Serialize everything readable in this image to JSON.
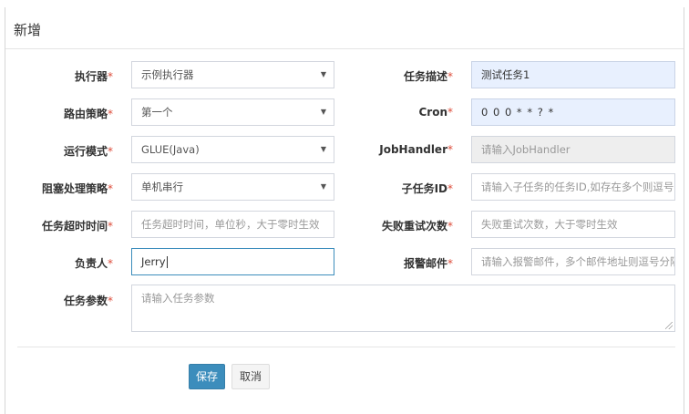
{
  "modal": {
    "title": "新增"
  },
  "form": {
    "executor": {
      "label": "执行器",
      "req": "*",
      "value": "示例执行器"
    },
    "job_desc": {
      "label": "任务描述",
      "req": "*",
      "value": "测试任务1"
    },
    "route_strategy": {
      "label": "路由策略",
      "req": "*",
      "value": "第一个"
    },
    "cron": {
      "label": "Cron",
      "req": "*",
      "value": "0 0 0 * * ? *"
    },
    "glue_type": {
      "label": "运行模式",
      "req": "*",
      "value": "GLUE(Java)"
    },
    "job_handler": {
      "label": "JobHandler",
      "req": "*",
      "placeholder": "请输入JobHandler"
    },
    "block_strategy": {
      "label": "阻塞处理策略",
      "req": "*",
      "value": "单机串行"
    },
    "child_job_id": {
      "label": "子任务ID",
      "req": "*",
      "placeholder": "请输入子任务的任务ID,如存在多个则逗号分隔"
    },
    "timeout": {
      "label": "任务超时时间",
      "req": "*",
      "placeholder": "任务超时时间，单位秒，大于零时生效"
    },
    "fail_retry": {
      "label": "失败重试次数",
      "req": "*",
      "placeholder": "失败重试次数，大于零时生效"
    },
    "author": {
      "label": "负责人",
      "req": "*",
      "value": "Jerry"
    },
    "alarm_email": {
      "label": "报警邮件",
      "req": "*",
      "placeholder": "请输入报警邮件，多个邮件地址则逗号分隔"
    },
    "executor_param": {
      "label": "任务参数",
      "req": "*",
      "placeholder": "请输入任务参数"
    }
  },
  "footer": {
    "save_label": "保存",
    "cancel_label": "取消"
  },
  "colors": {
    "primary": "#3c8dbc",
    "required": "#dd4b39",
    "autofill": "#e8f0fe"
  }
}
